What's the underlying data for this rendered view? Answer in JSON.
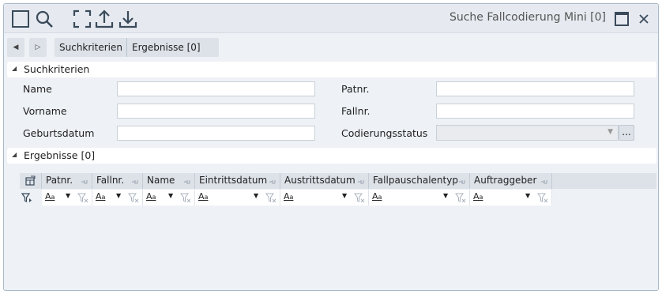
{
  "window": {
    "title": "Suche Fallcodierung Mini [0]"
  },
  "toolbar": {
    "icons": [
      "square-icon",
      "search-icon",
      "fullscreen-icon",
      "upload-icon",
      "download-icon"
    ]
  },
  "navigation": {
    "crumbs": [
      "Suchkriterien",
      "Ergebnisse [0]"
    ]
  },
  "search_section": {
    "title": "Suchkriterien",
    "fields": {
      "name_label": "Name",
      "vorname_label": "Vorname",
      "geburtsdatum_label": "Geburtsdatum",
      "patnr_label": "Patnr.",
      "fallnr_label": "Fallnr.",
      "codierungsstatus_label": "Codierungsstatus",
      "name_value": "",
      "vorname_value": "",
      "geburtsdatum_value": "",
      "patnr_value": "",
      "fallnr_value": "",
      "codierungsstatus_value": ""
    },
    "more_button": "..."
  },
  "results_section": {
    "title": "Ergebnisse [0]",
    "columns": [
      "Patnr.",
      "Fallnr.",
      "Name",
      "Eintrittsdatum",
      "Austrittsdatum",
      "Fallpauschalentyp",
      "Auftraggeber"
    ],
    "filter_text_icon": "Aa"
  },
  "colors": {
    "window_bg": "#eef1f5",
    "header_bg": "#dde2e9",
    "accent_icon": "#3a4a5a"
  }
}
